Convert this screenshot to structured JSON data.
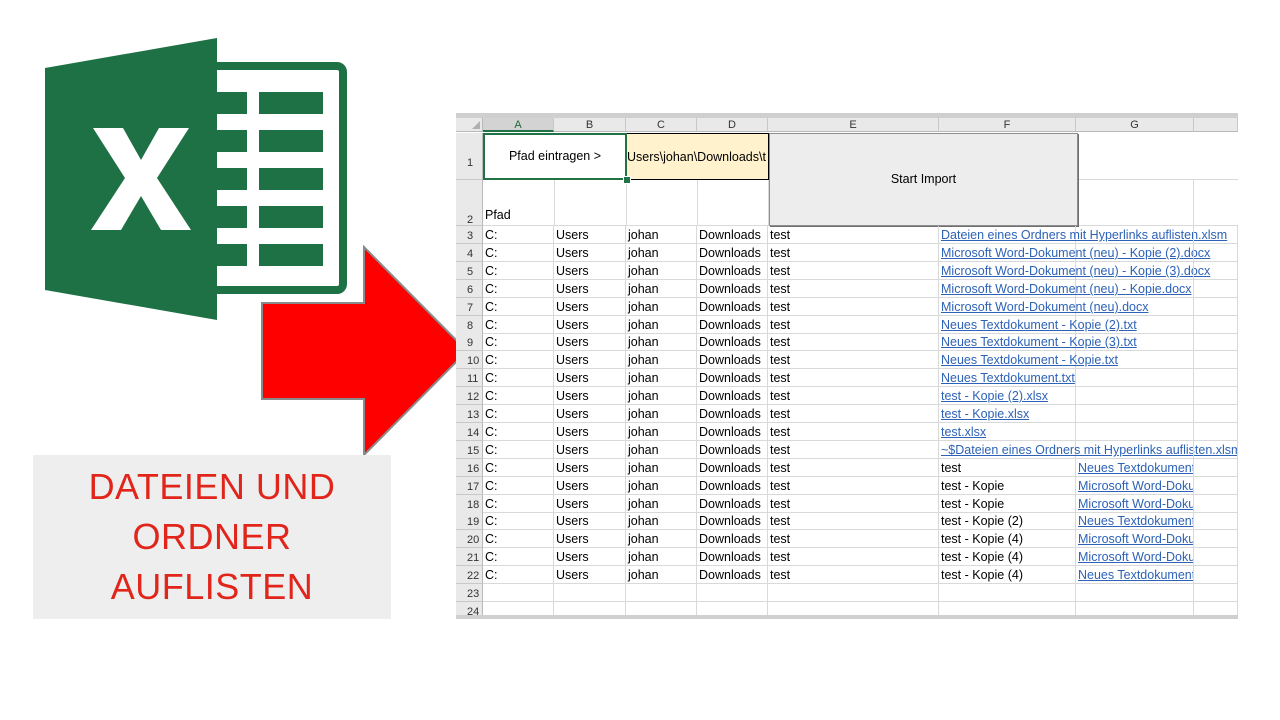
{
  "caption": {
    "lines": [
      "DATEIEN UND",
      "ORDNER",
      "AUFLISTEN"
    ]
  },
  "colors": {
    "excel_green": "#1e7145",
    "arrow_red": "#ff0000",
    "caption_red": "#e1251b",
    "path_fill": "#fff2cc",
    "hyperlink": "#2d62b7"
  },
  "icons": {
    "logo": "excel-logo-icon",
    "arrow": "arrow-right-icon"
  },
  "sheet": {
    "columns": [
      "A",
      "B",
      "C",
      "D",
      "E",
      "F",
      "G"
    ],
    "selected_column": "A",
    "pfad_button": "Pfad eintragen >",
    "path_value": "Users\\johan\\Downloads\\t",
    "import_button": "Start Import",
    "row2_label": "Pfad",
    "rows": [
      {
        "n": "3",
        "a": "C:",
        "b": "Users",
        "c": "johan",
        "d": "Downloads",
        "e": "test",
        "f": "Dateien eines Ordners mit Hyperlinks auflisten.xlsm",
        "f_link": true,
        "g": ""
      },
      {
        "n": "4",
        "a": "C:",
        "b": "Users",
        "c": "johan",
        "d": "Downloads",
        "e": "test",
        "f": "Microsoft Word-Dokument (neu) - Kopie (2).docx",
        "f_link": true,
        "g": ""
      },
      {
        "n": "5",
        "a": "C:",
        "b": "Users",
        "c": "johan",
        "d": "Downloads",
        "e": "test",
        "f": "Microsoft Word-Dokument (neu) - Kopie (3).docx",
        "f_link": true,
        "g": ""
      },
      {
        "n": "6",
        "a": "C:",
        "b": "Users",
        "c": "johan",
        "d": "Downloads",
        "e": "test",
        "f": "Microsoft Word-Dokument (neu) - Kopie.docx",
        "f_link": true,
        "g": ""
      },
      {
        "n": "7",
        "a": "C:",
        "b": "Users",
        "c": "johan",
        "d": "Downloads",
        "e": "test",
        "f": "Microsoft Word-Dokument (neu).docx",
        "f_link": true,
        "g": ""
      },
      {
        "n": "8",
        "a": "C:",
        "b": "Users",
        "c": "johan",
        "d": "Downloads",
        "e": "test",
        "f": "Neues Textdokument - Kopie (2).txt",
        "f_link": true,
        "g": ""
      },
      {
        "n": "9",
        "a": "C:",
        "b": "Users",
        "c": "johan",
        "d": "Downloads",
        "e": "test",
        "f": "Neues Textdokument - Kopie (3).txt",
        "f_link": true,
        "g": ""
      },
      {
        "n": "10",
        "a": "C:",
        "b": "Users",
        "c": "johan",
        "d": "Downloads",
        "e": "test",
        "f": "Neues Textdokument - Kopie.txt",
        "f_link": true,
        "g": ""
      },
      {
        "n": "11",
        "a": "C:",
        "b": "Users",
        "c": "johan",
        "d": "Downloads",
        "e": "test",
        "f": "Neues Textdokument.txt",
        "f_link": true,
        "g": ""
      },
      {
        "n": "12",
        "a": "C:",
        "b": "Users",
        "c": "johan",
        "d": "Downloads",
        "e": "test",
        "f": "test - Kopie (2).xlsx",
        "f_link": true,
        "g": ""
      },
      {
        "n": "13",
        "a": "C:",
        "b": "Users",
        "c": "johan",
        "d": "Downloads",
        "e": "test",
        "f": "test - Kopie.xlsx",
        "f_link": true,
        "g": ""
      },
      {
        "n": "14",
        "a": "C:",
        "b": "Users",
        "c": "johan",
        "d": "Downloads",
        "e": "test",
        "f": "test.xlsx",
        "f_link": true,
        "g": ""
      },
      {
        "n": "15",
        "a": "C:",
        "b": "Users",
        "c": "johan",
        "d": "Downloads",
        "e": "test",
        "f": "~$Dateien eines Ordners mit Hyperlinks auflisten.xlsm",
        "f_link": true,
        "g": ""
      },
      {
        "n": "16",
        "a": "C:",
        "b": "Users",
        "c": "johan",
        "d": "Downloads",
        "e": "test",
        "f": "test",
        "f_link": false,
        "g": "Neues Textdokument - Kopie"
      },
      {
        "n": "17",
        "a": "C:",
        "b": "Users",
        "c": "johan",
        "d": "Downloads",
        "e": "test",
        "f": "test - Kopie",
        "f_link": false,
        "g": "Microsoft Word-Dokument (n"
      },
      {
        "n": "18",
        "a": "C:",
        "b": "Users",
        "c": "johan",
        "d": "Downloads",
        "e": "test",
        "f": "test - Kopie",
        "f_link": false,
        "g": "Microsoft Word-Dokument (n"
      },
      {
        "n": "19",
        "a": "C:",
        "b": "Users",
        "c": "johan",
        "d": "Downloads",
        "e": "test",
        "f": "test - Kopie (2)",
        "f_link": false,
        "g": "Neues Textdokument - Kopie"
      },
      {
        "n": "20",
        "a": "C:",
        "b": "Users",
        "c": "johan",
        "d": "Downloads",
        "e": "test",
        "f": "test - Kopie (4)",
        "f_link": false,
        "g": "Microsoft Word-Dokument (n"
      },
      {
        "n": "21",
        "a": "C:",
        "b": "Users",
        "c": "johan",
        "d": "Downloads",
        "e": "test",
        "f": "test - Kopie (4)",
        "f_link": false,
        "g": "Microsoft Word-Dokument (n"
      },
      {
        "n": "22",
        "a": "C:",
        "b": "Users",
        "c": "johan",
        "d": "Downloads",
        "e": "test",
        "f": "test - Kopie (4)",
        "f_link": false,
        "g": "Neues Textdokument - Kopie"
      },
      {
        "n": "23",
        "a": "",
        "b": "",
        "c": "",
        "d": "",
        "e": "",
        "f": "",
        "f_link": false,
        "g": ""
      },
      {
        "n": "24",
        "a": "",
        "b": "",
        "c": "",
        "d": "",
        "e": "",
        "f": "",
        "f_link": false,
        "g": ""
      }
    ],
    "header_rows": [
      "1",
      "2"
    ]
  }
}
